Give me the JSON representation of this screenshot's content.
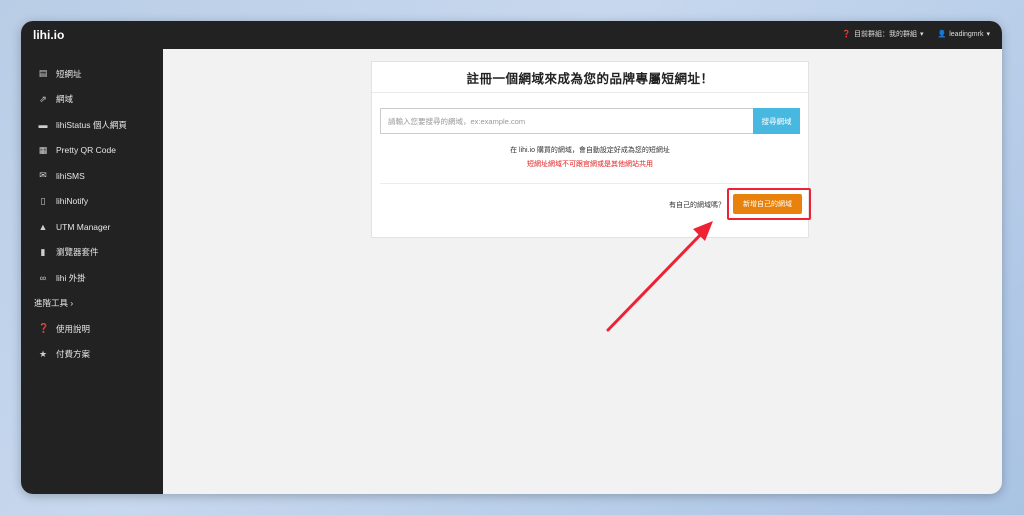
{
  "app": {
    "brand": "lihi.io"
  },
  "topbar": {
    "group_label": "目前群組：我的群組",
    "user_label": "leadingmrk"
  },
  "sidebar": {
    "items": [
      {
        "label": "短網址",
        "icon": "list-icon"
      },
      {
        "label": "網域",
        "icon": "external-link-icon"
      },
      {
        "label": "lihiStatus 個人網頁",
        "icon": "card-icon"
      },
      {
        "label": "Pretty QR Code",
        "icon": "qrcode-icon"
      },
      {
        "label": "lihiSMS",
        "icon": "envelope-icon"
      },
      {
        "label": "lihiNotify",
        "icon": "mobile-icon"
      },
      {
        "label": "UTM Manager",
        "icon": "utm-icon"
      },
      {
        "label": "瀏覽器套件",
        "icon": "bookmark-icon"
      },
      {
        "label": "lihi 外掛",
        "icon": "link-icon"
      }
    ],
    "section": "進階工具 ›",
    "bottom_items": [
      {
        "label": "使用說明",
        "icon": "question-icon"
      },
      {
        "label": "付費方案",
        "icon": "star-icon"
      }
    ]
  },
  "card": {
    "title": "註冊一個網域來成為您的品牌專屬短網址！",
    "search_placeholder": "請輸入您要搜尋的網域，ex:example.com",
    "search_button": "搜尋網域",
    "info_line": "在 lihi.io 購買的網域，會自動設定好成為您的短網址",
    "warning_line": "短網址網域不可跟官網或是其他網站共用",
    "own_domain_question": "有自己的網域嗎？",
    "add_button": "新增自己的網域"
  },
  "colors": {
    "accent_orange": "#e8820c",
    "search_blue": "#47b8e0",
    "highlight_red": "#ee2233",
    "warning_red": "#e02020"
  }
}
